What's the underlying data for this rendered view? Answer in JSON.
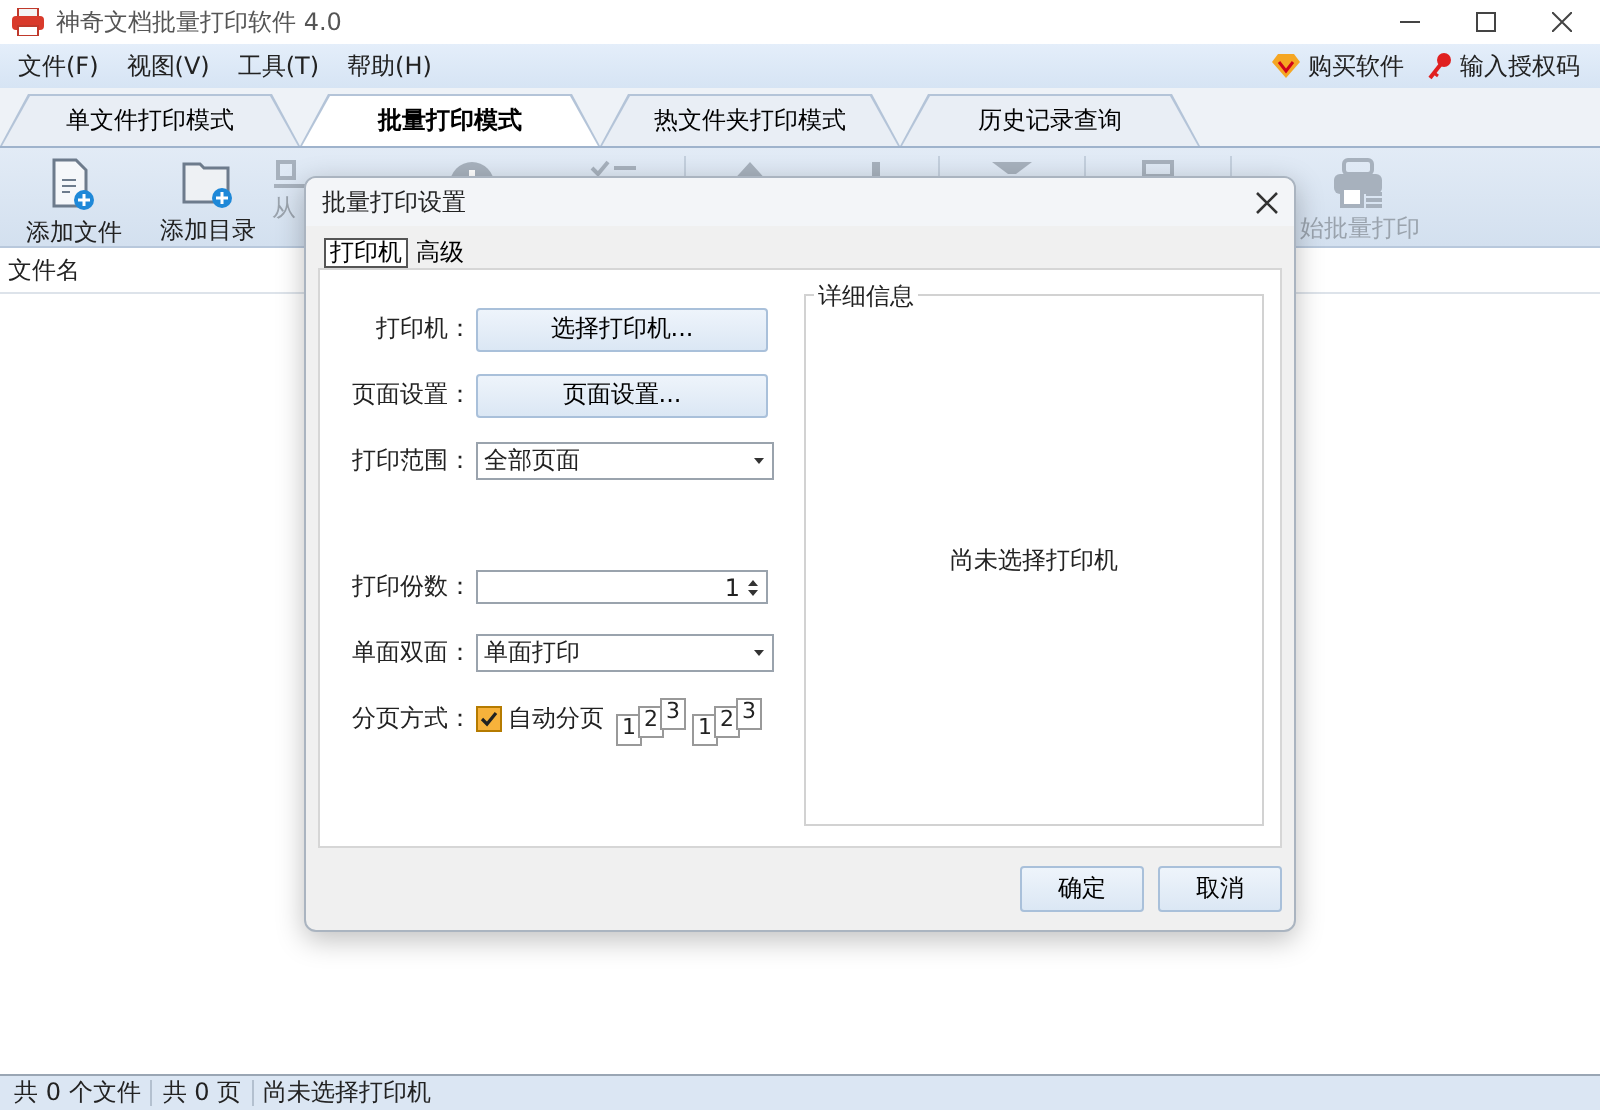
{
  "window": {
    "title": "神奇文档批量打印软件 4.0"
  },
  "menu": [
    {
      "label": "文件(F)"
    },
    {
      "label": "视图(V)"
    },
    {
      "label": "工具(T)"
    },
    {
      "label": "帮助(H)"
    }
  ],
  "menu_right": [
    {
      "label": "购买软件",
      "kind": "gem"
    },
    {
      "label": "输入授权码",
      "kind": "key"
    }
  ],
  "mode_tabs": [
    {
      "label": "单文件打印模式",
      "selected": false
    },
    {
      "label": "批量打印模式",
      "selected": true
    },
    {
      "label": "热文件夹打印模式",
      "selected": false
    },
    {
      "label": "历史记录查询",
      "selected": false
    }
  ],
  "toolbar": [
    {
      "label": "添加文件",
      "kind": "file-add",
      "disabled": false
    },
    {
      "label": "添加目录",
      "kind": "folder-add",
      "disabled": false
    },
    {
      "label": "从",
      "kind": "remove",
      "disabled": true
    },
    {
      "kind": "info",
      "disabled": true
    },
    {
      "kind": "checklist",
      "disabled": true
    },
    {
      "kind": "up",
      "disabled": true
    },
    {
      "kind": "down",
      "disabled": true
    },
    {
      "kind": "clear",
      "disabled": true
    },
    {
      "kind": "printer",
      "disabled": true
    },
    {
      "label": "始批量打印",
      "kind": "batch-print",
      "disabled": true
    }
  ],
  "file_list": {
    "columns": [
      "文件名"
    ]
  },
  "status_bar": [
    "共 0 个文件",
    "共 0 页",
    "尚未选择打印机"
  ],
  "dialog": {
    "title": "批量打印设置",
    "tabs": [
      {
        "label": "打印机",
        "selected": true
      },
      {
        "label": "高级",
        "selected": false
      }
    ],
    "fields": [
      {
        "kind": "button",
        "label": "打印机：",
        "value": "选择打印机..."
      },
      {
        "kind": "button",
        "label": "页面设置：",
        "value": "页面设置..."
      },
      {
        "kind": "select",
        "label": "打印范围：",
        "value": "全部页面"
      },
      {
        "kind": "spinner",
        "label": "打印份数：",
        "value": "1"
      },
      {
        "kind": "select",
        "label": "单面双面：",
        "value": "单面打印"
      },
      {
        "kind": "checkbox",
        "label": "分页方式：",
        "value": "自动分页",
        "checked": true,
        "samples": [
          [
            "1",
            "2",
            "3"
          ],
          [
            "1",
            "2",
            "3"
          ]
        ]
      }
    ],
    "details": {
      "title": "详细信息",
      "message": "尚未选择打印机"
    },
    "buttons": [
      {
        "label": "确定"
      },
      {
        "label": "取消"
      }
    ]
  }
}
